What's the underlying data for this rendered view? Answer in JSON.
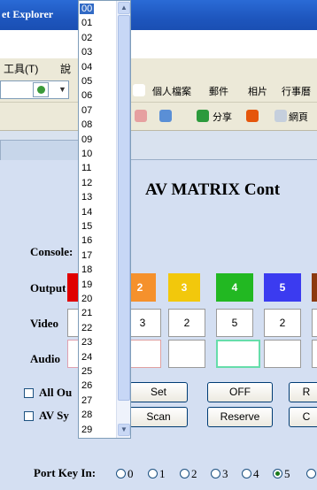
{
  "window": {
    "title": "et Explorer"
  },
  "menu": {
    "tools": "工具(T)",
    "help": "說"
  },
  "toolbar": {
    "personal_files": "個人檔案",
    "mail": "郵件",
    "photos": "相片",
    "calendar": "行事曆",
    "share": "分享",
    "web": "網頁"
  },
  "page": {
    "title": "AV MATRIX Cont",
    "console_label": "Console:",
    "output_label": "Output",
    "video_label": "Video",
    "audio_label": "Audio",
    "outputs": [
      {
        "num": "2",
        "color": "#f5912c"
      },
      {
        "num": "3",
        "color": "#f2c80c"
      },
      {
        "num": "4",
        "color": "#22b822"
      },
      {
        "num": "5",
        "color": "#3b3bf0"
      }
    ],
    "video_values": [
      "3",
      "2",
      "5",
      "2"
    ],
    "set_button": "Set",
    "off_button": "OFF",
    "r_button": "R",
    "scan_button": "Scan",
    "reserve_button": "Reserve",
    "c_button": "C",
    "all_output_label": "All Ou",
    "av_sync_label": "AV Sy",
    "port_key_label": "Port Key In:",
    "port_options": [
      "0",
      "1",
      "2",
      "3",
      "4",
      "5"
    ],
    "port_selected": "5"
  },
  "dropdown": {
    "options": [
      "00",
      "01",
      "02",
      "03",
      "04",
      "05",
      "06",
      "07",
      "08",
      "09",
      "10",
      "11",
      "12",
      "13",
      "14",
      "15",
      "16",
      "17",
      "18",
      "19",
      "20",
      "21",
      "22",
      "23",
      "24",
      "25",
      "26",
      "27",
      "28",
      "29"
    ],
    "selected": "00"
  }
}
